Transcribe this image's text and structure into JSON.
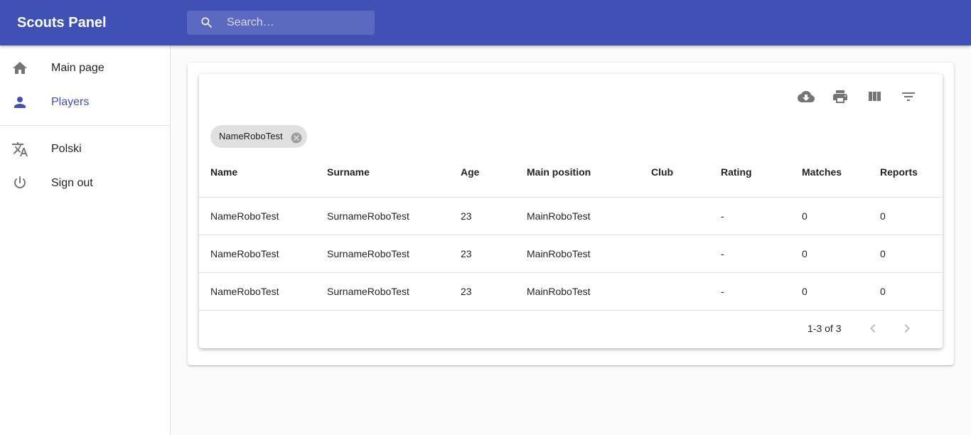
{
  "app": {
    "title": "Scouts Panel"
  },
  "search": {
    "placeholder": "Search…",
    "value": ""
  },
  "sidebar": {
    "items": [
      {
        "label": "Main page",
        "icon": "home-icon",
        "active": false
      },
      {
        "label": "Players",
        "icon": "person-icon",
        "active": true
      },
      {
        "label": "Polski",
        "icon": "translate-icon",
        "active": false
      },
      {
        "label": "Sign out",
        "icon": "power-icon",
        "active": false
      }
    ]
  },
  "toolbar": {
    "icons": [
      "cloud-download-icon",
      "print-icon",
      "view-column-icon",
      "filter-list-icon"
    ]
  },
  "filter_chip": {
    "label": "NameRoboTest"
  },
  "table": {
    "headers": [
      "Name",
      "Surname",
      "Age",
      "Main position",
      "Club",
      "Rating",
      "Matches",
      "Reports"
    ],
    "rows": [
      [
        "NameRoboTest",
        "SurnameRoboTest",
        "23",
        "MainRoboTest",
        "",
        "-",
        "0",
        "0"
      ],
      [
        "NameRoboTest",
        "SurnameRoboTest",
        "23",
        "MainRoboTest",
        "",
        "-",
        "0",
        "0"
      ],
      [
        "NameRoboTest",
        "SurnameRoboTest",
        "23",
        "MainRoboTest",
        "",
        "-",
        "0",
        "0"
      ]
    ]
  },
  "pagination": {
    "text": "1-3 of 3"
  },
  "colors": {
    "primary": "#3f51b5",
    "icon": "#757575",
    "background": "#fafafa"
  }
}
